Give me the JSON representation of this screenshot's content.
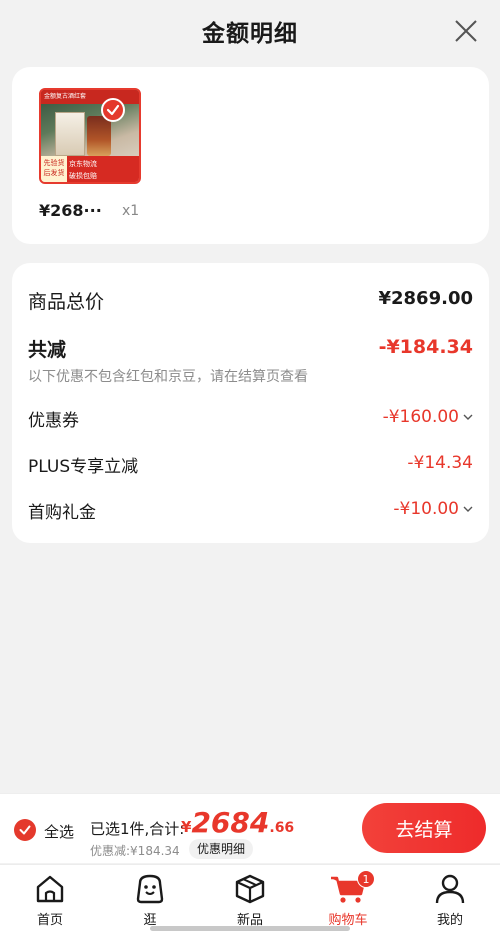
{
  "header": {
    "title": "金额明细"
  },
  "product": {
    "price": "¥268···",
    "quantity": "x1",
    "image": {
      "banner_text": "金额复古酒红套",
      "left_tag": "先验货 后发货",
      "right_tag_line1": "京东物流",
      "right_tag_line2": "破损包赔"
    }
  },
  "details": {
    "total_label": "商品总价",
    "total_value": "¥2869.00",
    "reduce_label": "共减",
    "reduce_value": "-¥184.34",
    "reduce_note": "以下优惠不包含红包和京豆，请在结算页查看",
    "items": [
      {
        "label": "优惠券",
        "value": "-¥160.00",
        "expandable": true
      },
      {
        "label": "PLUS专享立减",
        "value": "-¥14.34",
        "expandable": false
      },
      {
        "label": "首购礼金",
        "value": "-¥10.00",
        "expandable": true
      }
    ]
  },
  "checkout": {
    "select_all": "全选",
    "selected_text": "已选1件,合计:",
    "total_yen": "¥",
    "total_int": "2684",
    "total_dec": ".66",
    "discount_text": "优惠减:¥184.34",
    "detail_link": "优惠明细",
    "button": "去结算"
  },
  "tabbar": {
    "items": [
      {
        "label": "首页",
        "icon": "home-icon"
      },
      {
        "label": "逛",
        "icon": "browse-icon"
      },
      {
        "label": "新品",
        "icon": "box-icon"
      },
      {
        "label": "购物车",
        "icon": "cart-icon",
        "badge": "1",
        "active": true
      },
      {
        "label": "我的",
        "icon": "user-icon"
      }
    ]
  },
  "colors": {
    "accent": "#e8372b",
    "background": "#f2f2f2",
    "card": "#ffffff"
  }
}
